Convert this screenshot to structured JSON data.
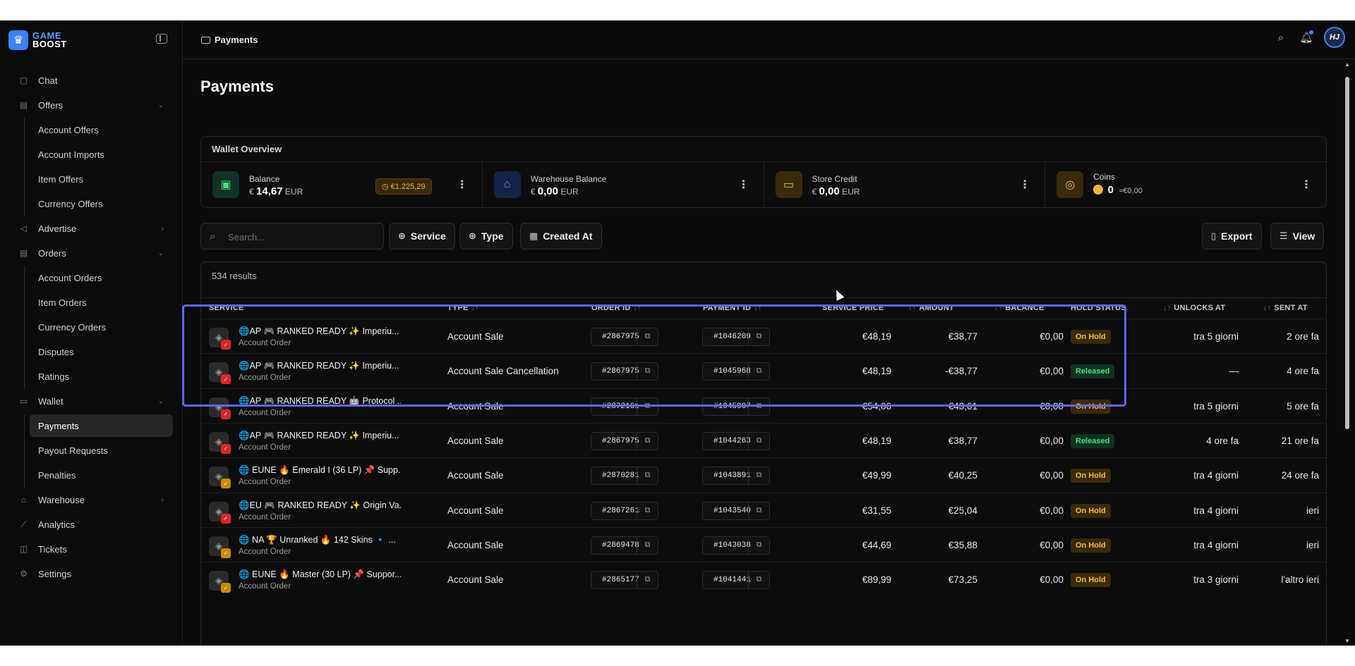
{
  "app": {
    "logo_line1": "GAME",
    "logo_line2": "BOOST"
  },
  "breadcrumb": "Payments",
  "avatar_initials": "HJ",
  "sidebar": {
    "chat": "Chat",
    "offers": "Offers",
    "offers_items": [
      "Account Offers",
      "Account Imports",
      "Item Offers",
      "Currency Offers"
    ],
    "advertise": "Advertise",
    "orders": "Orders",
    "orders_items": [
      "Account Orders",
      "Item Orders",
      "Currency Orders",
      "Disputes",
      "Ratings"
    ],
    "wallet": "Wallet",
    "wallet_items": [
      "Payments",
      "Payout Requests",
      "Penalties"
    ],
    "warehouse": "Warehouse",
    "analytics": "Analytics",
    "tickets": "Tickets",
    "settings": "Settings"
  },
  "page_title": "Payments",
  "wallet": {
    "title": "Wallet Overview",
    "balance": {
      "label": "Balance",
      "currency": "€",
      "value": "14,67",
      "unit": "EUR",
      "pending": "€1.225,29"
    },
    "warehouse": {
      "label": "Warehouse Balance",
      "currency": "€",
      "value": "0,00",
      "unit": "EUR"
    },
    "store_credit": {
      "label": "Store Credit",
      "currency": "€",
      "value": "0,00",
      "unit": "EUR"
    },
    "coins": {
      "label": "Coins",
      "value": "0",
      "approx": "≈€0,00"
    }
  },
  "toolbar": {
    "search_placeholder": "Search...",
    "service": "Service",
    "type": "Type",
    "created_at": "Created At",
    "export": "Export",
    "view": "View"
  },
  "table": {
    "results": "534 results",
    "headers": {
      "service": "Service",
      "type": "Type",
      "order_id": "Order ID",
      "payment_id": "Payment ID",
      "service_price": "Service Price",
      "amount": "Amount",
      "balance": "Balance",
      "hold_status": "Hold Status",
      "unlocks_at": "Unlocks At",
      "sent_at": "Sent At"
    },
    "rows": [
      {
        "name": "🌐AP 🎮 RANKED READY ✨ Imperiu...",
        "sub": "Account Order",
        "type": "Account Sale",
        "order_id": "#2867975",
        "payment_id": "#1046209",
        "price": "€48,19",
        "amount": "€38,77",
        "balance": "€0,00",
        "status": "On Hold",
        "unlocks": "tra 5 giorni",
        "sent": "2 ore fa"
      },
      {
        "name": "🌐AP 🎮 RANKED READY ✨ Imperiu...",
        "sub": "Account Order",
        "type": "Account Sale Cancellation",
        "order_id": "#2867975",
        "payment_id": "#1045968",
        "price": "€48,19",
        "amount": "-€38,77",
        "balance": "€0,00",
        "status": "Released",
        "unlocks": "—",
        "sent": "4 ore fa"
      },
      {
        "name": "🌐AP 🎮 RANKED READY 🤖 Protocol ...",
        "sub": "Account Order",
        "type": "Account Sale",
        "order_id": "#2872161",
        "payment_id": "#1045907",
        "price": "€54,06",
        "amount": "€43,61",
        "balance": "€0,00",
        "status": "On Hold",
        "unlocks": "tra 5 giorni",
        "sent": "5 ore fa"
      },
      {
        "name": "🌐AP 🎮 RANKED READY ✨ Imperiu...",
        "sub": "Account Order",
        "type": "Account Sale",
        "order_id": "#2867975",
        "payment_id": "#1044263",
        "price": "€48,19",
        "amount": "€38,77",
        "balance": "€0,00",
        "status": "Released",
        "unlocks": "4 ore fa",
        "sent": "21 ore fa"
      },
      {
        "name": "🌐 EUNE 🔥 Emerald I (36 LP) 📌 Supp...",
        "sub": "Account Order",
        "type": "Account Sale",
        "order_id": "#2870281",
        "payment_id": "#1043891",
        "price": "€49,99",
        "amount": "€40,25",
        "balance": "€0,00",
        "status": "On Hold",
        "unlocks": "tra 4 giorni",
        "sent": "24 ore fa"
      },
      {
        "name": "🌐EU 🎮 RANKED READY ✨ Origin Va...",
        "sub": "Account Order",
        "type": "Account Sale",
        "order_id": "#2867261",
        "payment_id": "#1043540",
        "price": "€31,55",
        "amount": "€25,04",
        "balance": "€0,00",
        "status": "On Hold",
        "unlocks": "tra 4 giorni",
        "sent": "ieri"
      },
      {
        "name": "🌐 NA 🏆 Unranked 🔥 142 Skins 🔹 ...",
        "sub": "Account Order",
        "type": "Account Sale",
        "order_id": "#2869478",
        "payment_id": "#1043038",
        "price": "€44,69",
        "amount": "€35,88",
        "balance": "€0,00",
        "status": "On Hold",
        "unlocks": "tra 4 giorni",
        "sent": "ieri"
      },
      {
        "name": "🌐 EUNE 🔥 Master (30 LP) 📌 Suppor...",
        "sub": "Account Order",
        "type": "Account Sale",
        "order_id": "#2865177",
        "payment_id": "#1041441",
        "price": "€89,99",
        "amount": "€73,25",
        "balance": "€0,00",
        "status": "On Hold",
        "unlocks": "tra 3 giorni",
        "sent": "l'altro ieri"
      }
    ]
  },
  "colors": {
    "accent": "#3b82f6",
    "highlight": "#6366f1",
    "hold": "#f4b740",
    "released": "#4ade80"
  }
}
